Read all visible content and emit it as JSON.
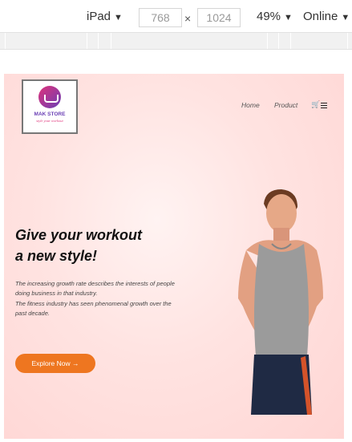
{
  "devtools": {
    "device": "iPad",
    "width": "768",
    "height": "1024",
    "times_sign": "×",
    "zoom": "49%",
    "network": "Online",
    "caret": "▼"
  },
  "site": {
    "logo": {
      "title": "MAK STORE",
      "tagline": "style your workout"
    },
    "nav": {
      "home": "Home",
      "product": "Product"
    },
    "hero": {
      "title_line1": "Give your workout",
      "title_line2": "a new style!",
      "paragraph1": "The increasing growth rate describes the interests of people doing business in that industry.",
      "paragraph2": "The fitness industry has seen phenomenal growth over the past decade.",
      "button": "Explore Now →"
    },
    "colors": {
      "accent": "#ee7620",
      "background": "#ffd6d4",
      "logo_purple": "#6a3fb5",
      "logo_pink": "#e0337a"
    }
  }
}
